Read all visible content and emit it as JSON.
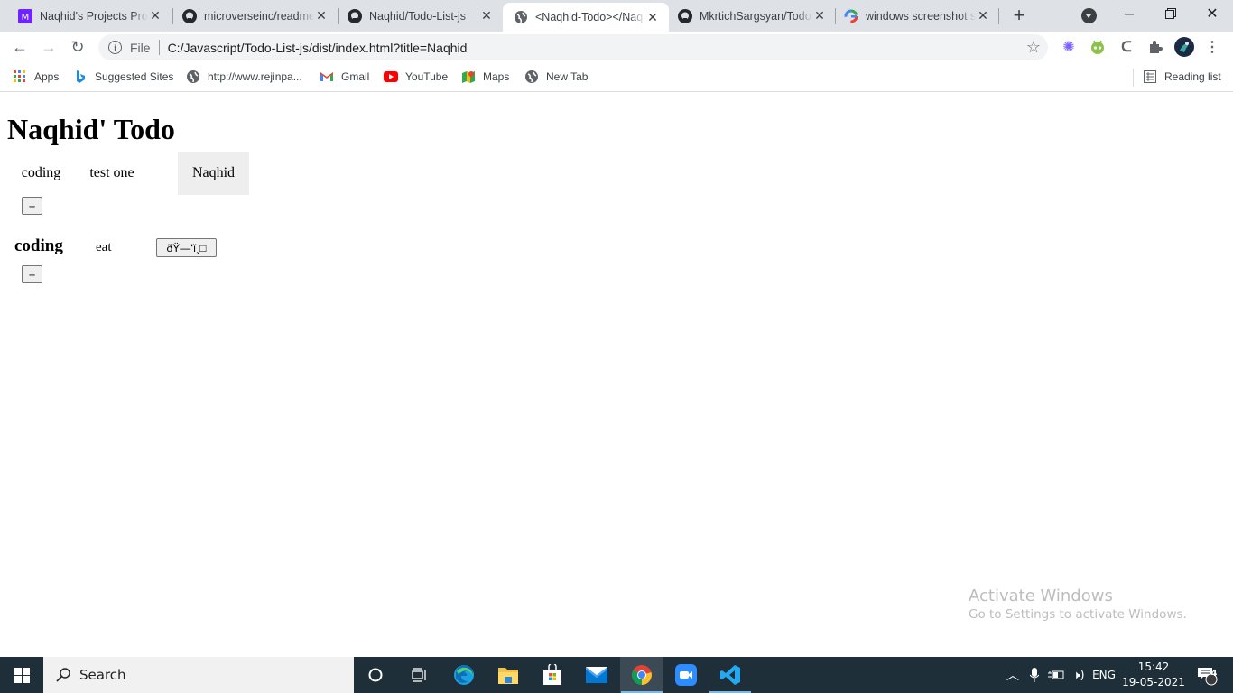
{
  "browser": {
    "tabs": [
      {
        "title": "Naqhid's Projects Progress",
        "icon": "microverse-icon",
        "active": false
      },
      {
        "title": "microverseinc/readme-template",
        "icon": "github-icon",
        "active": false
      },
      {
        "title": "Naqhid/Todo-List-js",
        "icon": "github-icon",
        "active": false
      },
      {
        "title": "<Naqhid-Todo></Naqhid-Todo>",
        "icon": "globe-icon",
        "active": true
      },
      {
        "title": "MkrtichSargsyan/Todo-list",
        "icon": "github-icon",
        "active": false
      },
      {
        "title": "windows screenshot shortcut",
        "icon": "google-icon",
        "active": false
      }
    ],
    "new_tab_label": "+",
    "address": {
      "scheme_label": "File",
      "url": "C:/Javascript/Todo-List-js/dist/index.html?title=Naqhid"
    },
    "bookmarks": [
      {
        "label": "Apps",
        "icon": "apps-grid-icon"
      },
      {
        "label": "Suggested Sites",
        "icon": "bing-icon"
      },
      {
        "label": "http://www.rejinpa...",
        "icon": "globe-icon"
      },
      {
        "label": "Gmail",
        "icon": "gmail-icon"
      },
      {
        "label": "YouTube",
        "icon": "youtube-icon"
      },
      {
        "label": "Maps",
        "icon": "maps-icon"
      },
      {
        "label": "New Tab",
        "icon": "globe-icon"
      }
    ],
    "reading_list_label": "Reading list"
  },
  "page": {
    "heading": "Naqhid' Todo",
    "projects": [
      {
        "name": "coding",
        "active": false
      },
      {
        "name": "test one",
        "active": false
      },
      {
        "name": "Naqhid",
        "active": true
      }
    ],
    "add_project_label": "+",
    "current_project": {
      "title": "coding",
      "tasks": [
        {
          "name": "eat",
          "delete_label": "ðŸ—‘ï¸□"
        }
      ]
    },
    "add_task_label": "+"
  },
  "watermark": {
    "line1": "Activate Windows",
    "line2": "Go to Settings to activate Windows."
  },
  "taskbar": {
    "search_placeholder": "Search",
    "language": "ENG",
    "time": "15:42",
    "date": "19-05-2021",
    "notification_count": "4"
  }
}
